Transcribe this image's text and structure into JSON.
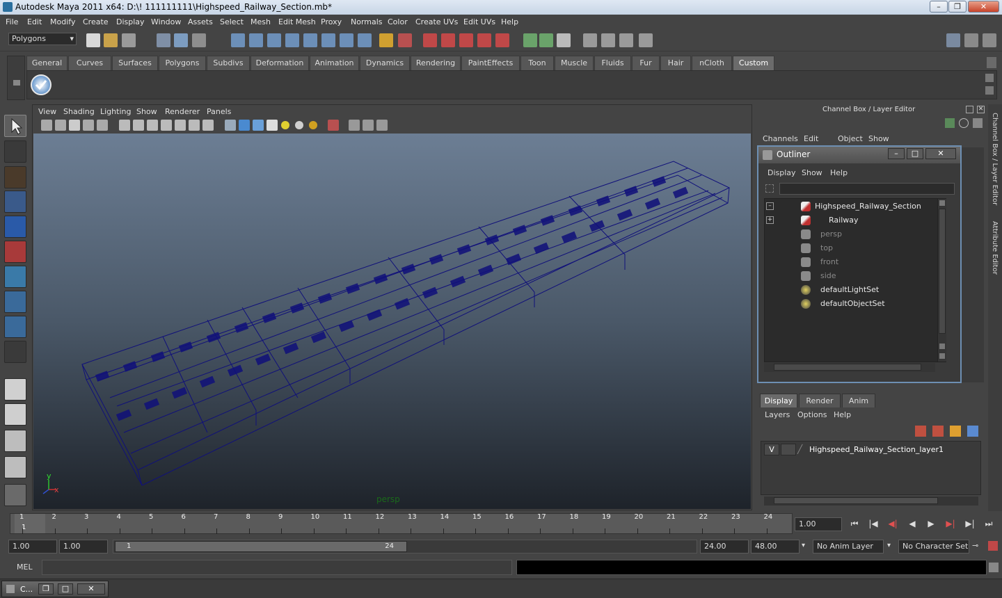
{
  "window": {
    "title": "Autodesk Maya 2011 x64: D:\\! 111111111\\Highspeed_Railway_Section.mb*",
    "controls": [
      "–",
      "❐",
      "✕"
    ]
  },
  "menubar": [
    "File",
    "Edit",
    "Modify",
    "Create",
    "Display",
    "Window",
    "Assets",
    "Select",
    "Mesh",
    "Edit Mesh",
    "Proxy",
    "Normals",
    "Color",
    "Create UVs",
    "Edit UVs",
    "Help"
  ],
  "status": {
    "mode": "Polygons"
  },
  "shelf": {
    "tabs": [
      "General",
      "Curves",
      "Surfaces",
      "Polygons",
      "Subdivs",
      "Deformation",
      "Animation",
      "Dynamics",
      "Rendering",
      "PaintEffects",
      "Toon",
      "Muscle",
      "Fluids",
      "Fur",
      "Hair",
      "nCloth",
      "Custom"
    ],
    "active": "Custom"
  },
  "viewport": {
    "menu": [
      "View",
      "Shading",
      "Lighting",
      "Show",
      "Renderer",
      "Panels"
    ],
    "camera_label": "persp",
    "axis": {
      "y": "y",
      "x": "x"
    }
  },
  "channelbox": {
    "title": "Channel Box / Layer Editor",
    "menu": [
      "Channels",
      "Edit",
      "Object",
      "Show"
    ]
  },
  "outliner": {
    "title": "Outliner",
    "menu": [
      "Display",
      "Show",
      "Help"
    ],
    "items": [
      {
        "label": "Highspeed_Railway_Section",
        "expander": "–"
      },
      {
        "label": "Railway",
        "expander": "+"
      },
      {
        "label": "persp"
      },
      {
        "label": "top"
      },
      {
        "label": "front"
      },
      {
        "label": "side"
      },
      {
        "label": "defaultLightSet"
      },
      {
        "label": "defaultObjectSet"
      }
    ]
  },
  "sidetabs": [
    "Channel Box / Layer Editor",
    "Attribute Editor"
  ],
  "layers": {
    "tabs": [
      "Display",
      "Render",
      "Anim"
    ],
    "menu": [
      "Layers",
      "Options",
      "Help"
    ],
    "row": {
      "visible": "V",
      "name": "Highspeed_Railway_Section_layer1"
    }
  },
  "timeline": {
    "ticks": [
      "1",
      "2",
      "3",
      "4",
      "5",
      "6",
      "7",
      "8",
      "9",
      "10",
      "11",
      "12",
      "13",
      "14",
      "15",
      "16",
      "17",
      "18",
      "19",
      "20",
      "21",
      "22",
      "23",
      "24"
    ],
    "current_frame_marker": "1",
    "current_time": "1.00",
    "playback": [
      "⏮",
      "|◀",
      "◀|",
      "◀",
      "▶",
      "▶|",
      "▶|",
      "⏭"
    ]
  },
  "range": {
    "start_time": "1.00",
    "playback_start": "1.00",
    "slider_start": "1",
    "slider_end": "24",
    "playback_end": "24.00",
    "end_time": "48.00",
    "anim_layer": "No Anim Layer",
    "character_set": "No Character Set"
  },
  "commandline": {
    "label": "MEL"
  },
  "taskbar": {
    "item": "C..."
  },
  "colors": {
    "wireframe": "#10107a",
    "outliner_border": "#6d8fb3",
    "active_tab": "#6b6b6b"
  }
}
